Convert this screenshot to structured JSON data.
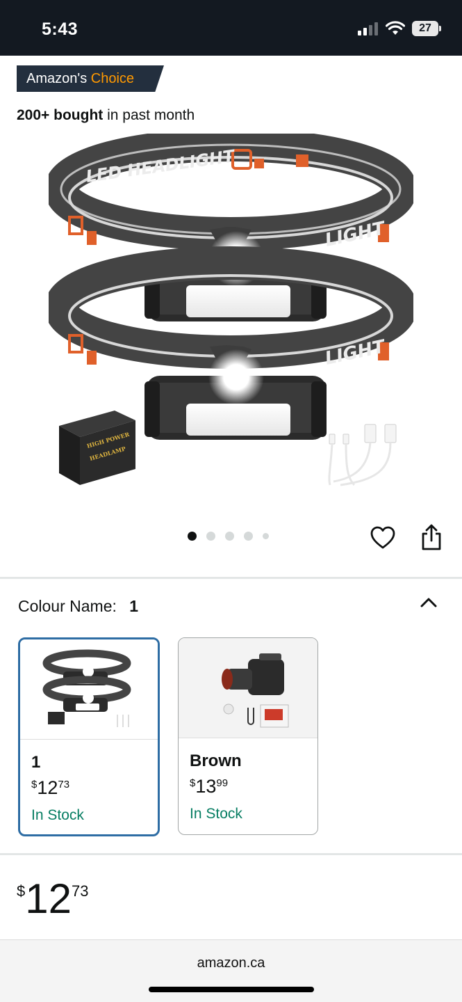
{
  "status_bar": {
    "time": "5:43",
    "battery": "27"
  },
  "badge": {
    "prefix": "Amazon's",
    "accent": "Choice"
  },
  "social_proof": {
    "bold": "200+ bought",
    "rest": "in past month"
  },
  "product_image": {
    "band_text": "LED HEADLIGHT",
    "band_side_text": "LED",
    "band_right_text": "LIGHT",
    "box_text_1": "HIGH POWER",
    "box_text_2": "HEADLAMP"
  },
  "carousel": {
    "count": 5,
    "active_index": 0
  },
  "icons": {
    "wishlist": "heart-icon",
    "share": "share-icon",
    "collapse": "chevron-up-icon"
  },
  "colour": {
    "label": "Colour Name:",
    "value": "1"
  },
  "swatches": [
    {
      "name": "1",
      "currency": "$",
      "whole": "12",
      "cents": "73",
      "stock": "In Stock",
      "selected": true
    },
    {
      "name": "Brown",
      "currency": "$",
      "whole": "13",
      "cents": "99",
      "stock": "In Stock",
      "selected": false
    }
  ],
  "price": {
    "currency": "$",
    "whole": "12",
    "cents": "73"
  },
  "browser": {
    "url": "amazon.ca"
  },
  "colors": {
    "header": "#131921",
    "accent": "#ff9900",
    "stock": "#067d62",
    "selected_border": "#2e6da4"
  }
}
